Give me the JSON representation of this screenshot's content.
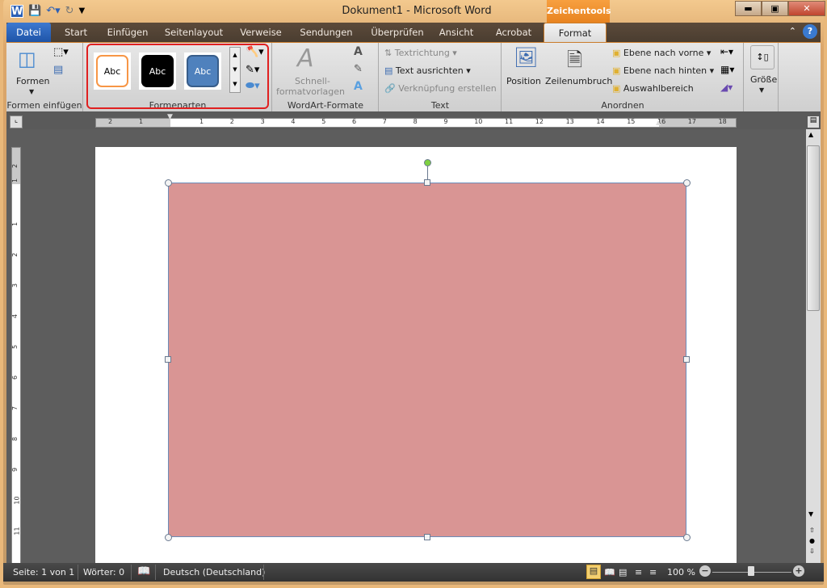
{
  "window": {
    "title": "Dokument1  -  Microsoft Word",
    "context_tab_group": "Zeichentools"
  },
  "qat": {
    "word_icon": "W",
    "save": "save-icon",
    "undo": "undo-icon",
    "redo": "redo-icon",
    "customize": "customize-icon"
  },
  "tabs": [
    {
      "label": "Datei"
    },
    {
      "label": "Start"
    },
    {
      "label": "Einfügen"
    },
    {
      "label": "Seitenlayout"
    },
    {
      "label": "Verweise"
    },
    {
      "label": "Sendungen"
    },
    {
      "label": "Überprüfen"
    },
    {
      "label": "Ansicht"
    },
    {
      "label": "Acrobat"
    },
    {
      "label": "Format",
      "active": true
    }
  ],
  "ribbon": {
    "formen_einfuegen": {
      "label": "Formen einfügen",
      "formen": "Formen"
    },
    "formenarten": {
      "label": "Formenarten",
      "styles": [
        "Abc",
        "Abc",
        "Abc"
      ]
    },
    "wordart": {
      "label": "WordArt-Formate",
      "schnell1": "Schnell-",
      "schnell2": "formatvorlagen"
    },
    "text": {
      "label": "Text",
      "textrichtung": "Textrichtung",
      "ausrichten": "Text ausrichten",
      "verknuepfung": "Verknüpfung erstellen"
    },
    "anordnen": {
      "label": "Anordnen",
      "position": "Position",
      "zeilenumbruch": "Zeilenumbruch",
      "vorne": "Ebene nach vorne",
      "hinten": "Ebene nach hinten",
      "auswahl": "Auswahlbereich"
    },
    "groesse": {
      "label": "Größe"
    }
  },
  "ruler": {
    "h_left": [
      "2",
      "1"
    ],
    "h": [
      "1",
      "2",
      "3",
      "4",
      "5",
      "6",
      "7",
      "8",
      "9",
      "10",
      "11",
      "12",
      "13",
      "14",
      "15",
      "16",
      "17",
      "18"
    ],
    "v": [
      "2",
      "1",
      "1",
      "2",
      "3",
      "4",
      "5",
      "6",
      "7",
      "8",
      "9",
      "10",
      "11"
    ]
  },
  "shape": {
    "fill": "#d99594",
    "border": "#6b8cb8"
  },
  "status": {
    "page": "Seite: 1 von 1",
    "words": "Wörter: 0",
    "language": "Deutsch (Deutschland)",
    "zoom": "100 %",
    "zoom_level": 100
  }
}
